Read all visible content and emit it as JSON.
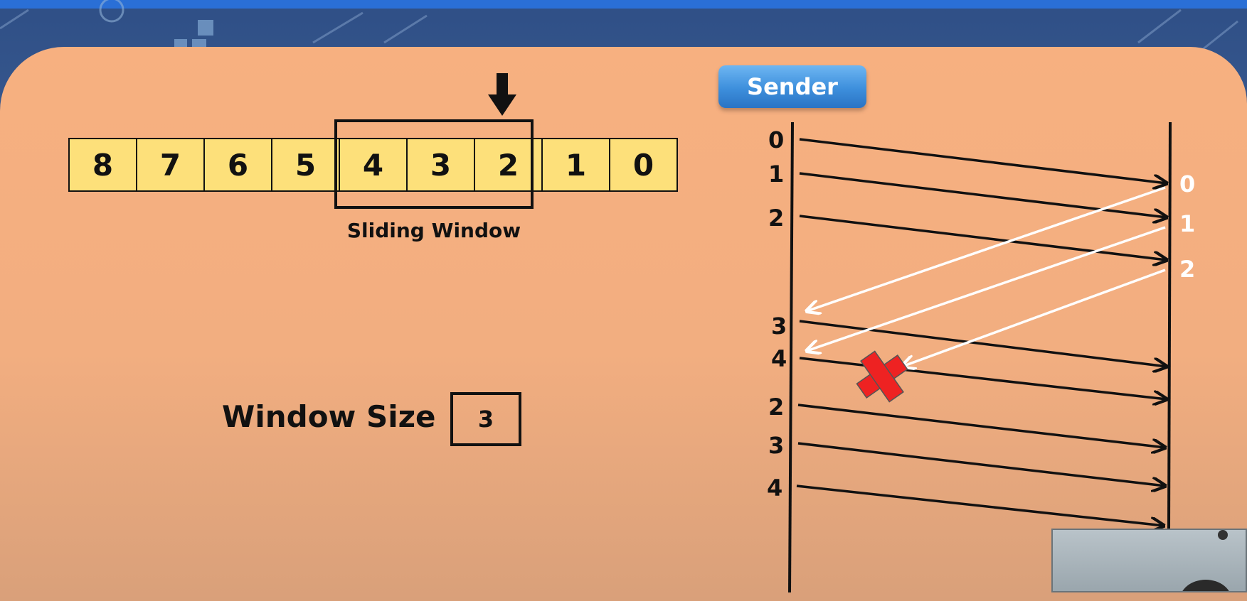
{
  "frames": {
    "strip": [
      "8",
      "7",
      "6",
      "5",
      "4",
      "3",
      "2",
      "1",
      "0"
    ],
    "window_label": "Sliding Window"
  },
  "window_size": {
    "label": "Window Size",
    "value": "3"
  },
  "sender": {
    "label": "Sender"
  },
  "sequence": {
    "sent_labels": [
      "0",
      "1",
      "2",
      "3",
      "4",
      "2",
      "3",
      "4"
    ],
    "ack_labels": [
      "0",
      "1",
      "2"
    ]
  },
  "colors": {
    "panel": "#f5b084",
    "frame_fill": "#fde07a",
    "sender_button": "#3d8fdc",
    "loss_marker": "#ee2222",
    "ack_arrow": "#ffffff",
    "frame_arrow": "#111111"
  }
}
